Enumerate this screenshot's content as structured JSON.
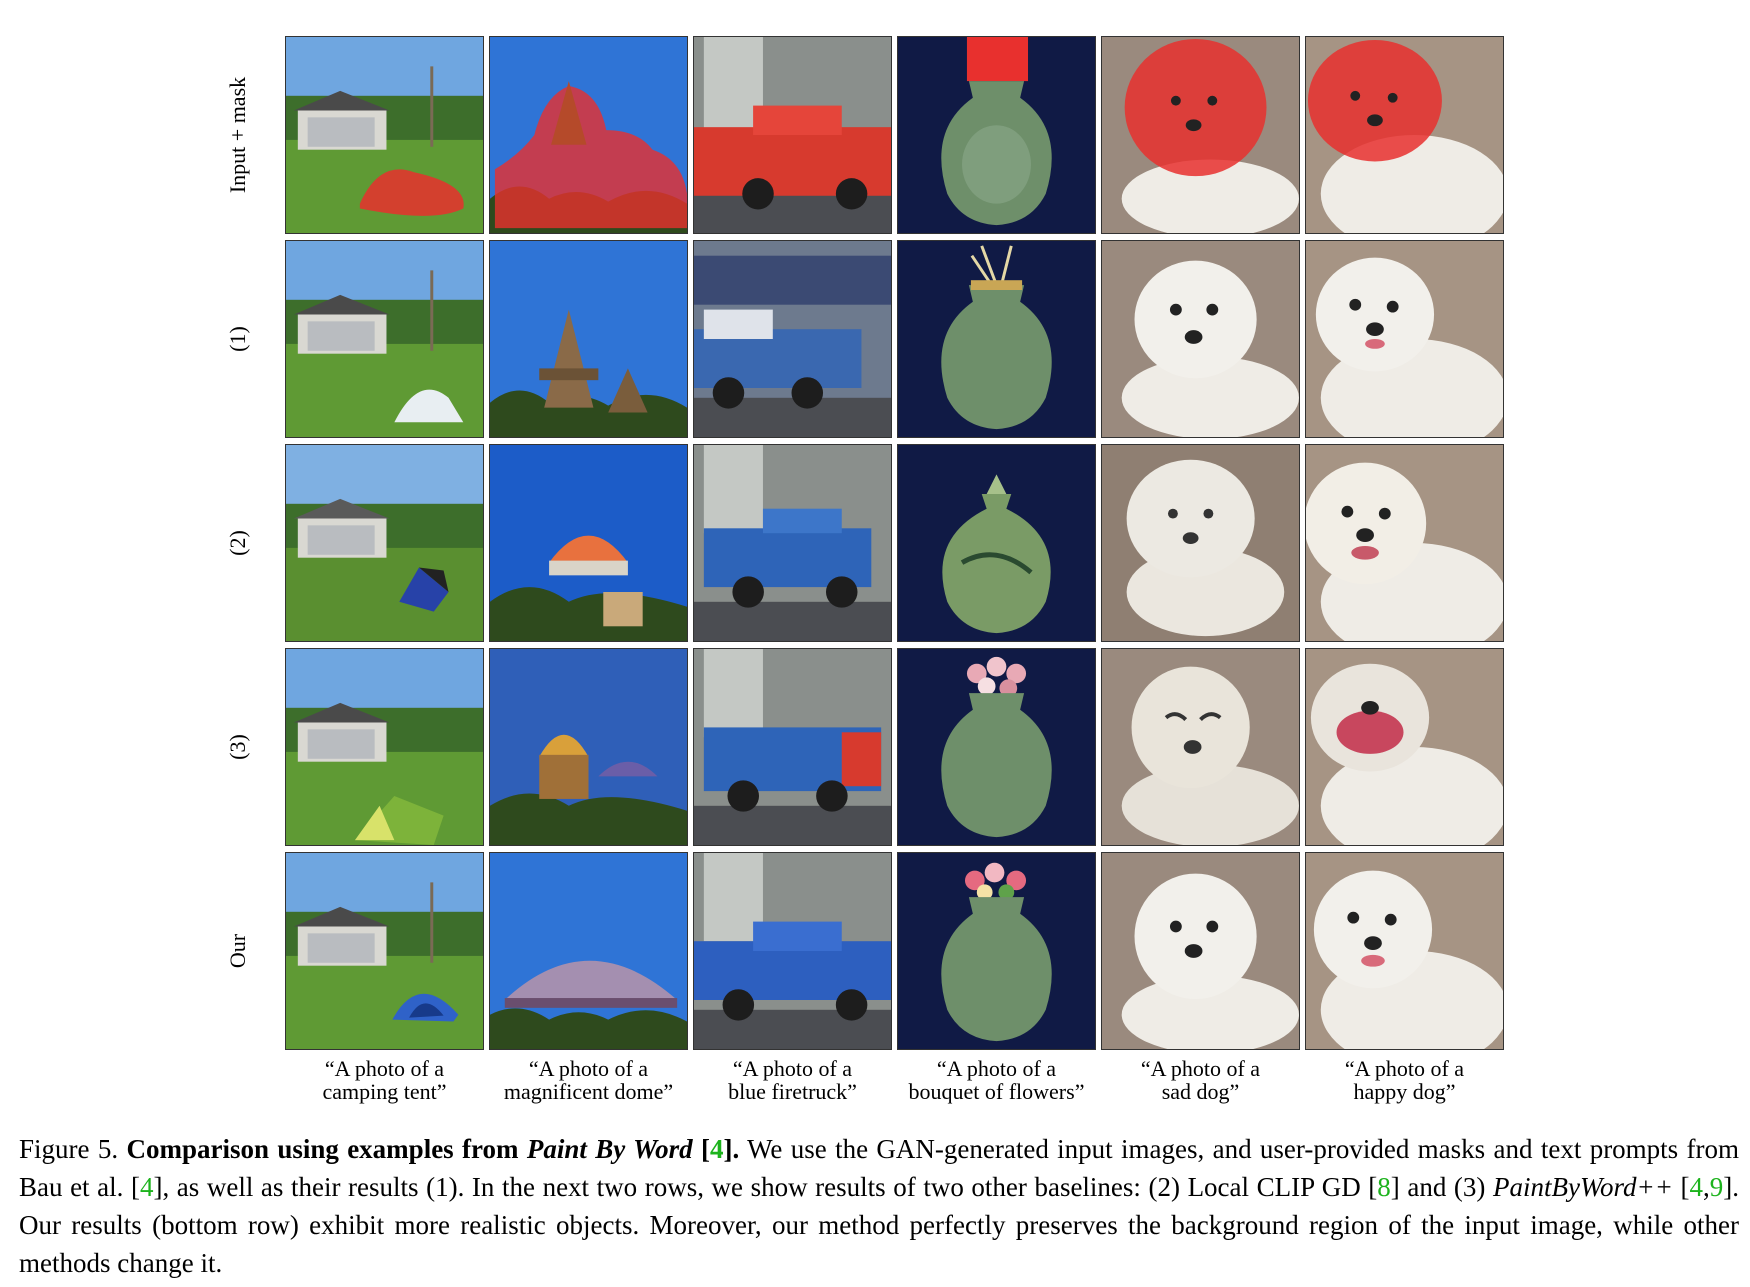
{
  "row_labels": [
    "Input + mask",
    "(1)",
    "(2)",
    "(3)",
    "Our"
  ],
  "prompts": [
    {
      "line1": "“A photo of a",
      "line2": "camping tent”"
    },
    {
      "line1": "“A photo of a",
      "line2": "magnificent dome”"
    },
    {
      "line1": "“A photo of a",
      "line2": "blue firetruck”"
    },
    {
      "line1": "“A photo of a",
      "line2": "bouquet of flowers”"
    },
    {
      "line1": "“A photo of a",
      "line2": "sad dog”"
    },
    {
      "line1": "“A photo of a",
      "line2": "happy dog”"
    }
  ],
  "caption": {
    "fig_label": "Figure 5.",
    "bold_a": "Comparison using examples from",
    "bold_italic": "Paint By Word",
    "cite_4a": "4",
    "t1": "We use the GAN-generated input images, and user-provided masks and text prompts from Bau et al.",
    "cite_4b": "4",
    "t2": ", as well as their results (1). In the next two rows, we show results of two other baselines: (2) Local CLIP GD",
    "cite_8": "8",
    "t3": "and (3)",
    "italic_pbw": "PaintByWord++",
    "cite_4c": "4",
    "cite_9": "9",
    "t4": ". Our results (bottom row) exhibit more realistic objects. Moreover, our method perfectly preserves the background region of the input image, while other methods change it."
  },
  "colors": {
    "mask": "#e8302e",
    "sky": "#3a7fd6",
    "grass": "#4f8a2c",
    "vase": "#6e8f6a",
    "dog": "#efece6",
    "navy": "#101a45",
    "citation": "#1db31d"
  }
}
